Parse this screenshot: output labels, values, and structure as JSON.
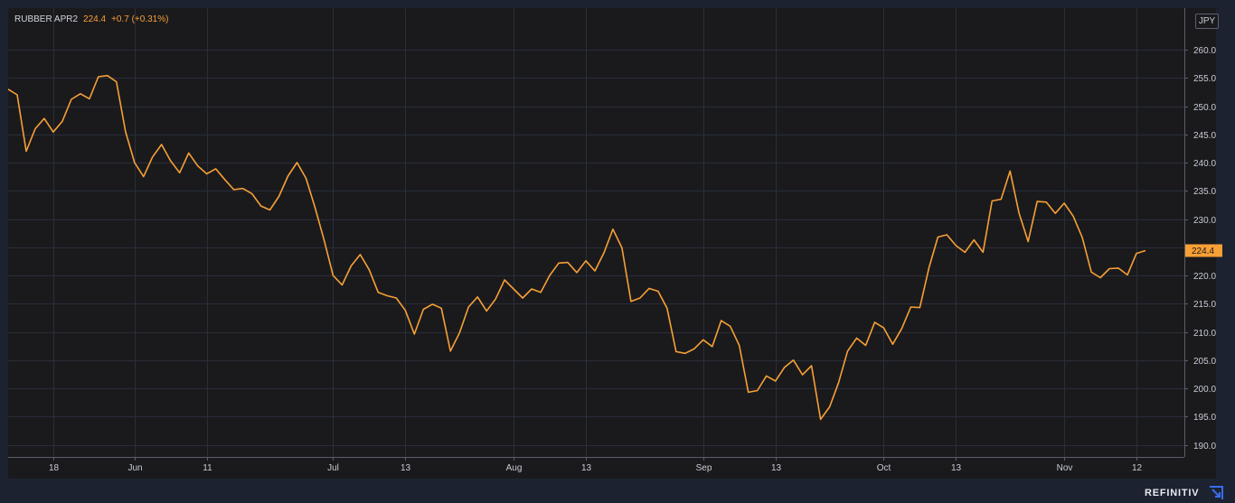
{
  "legend": {
    "symbol": "RUBBER APR2",
    "price": "224.4",
    "change": "+0.7 (+0.31%)"
  },
  "currency": "JPY",
  "brand": {
    "name": "REFINITIV",
    "logo_icon": "refinitiv-logo-icon"
  },
  "colors": {
    "background": "#1a1a1d",
    "frame": "#1c2230",
    "line": "#f7a035",
    "grid": "#2a2e39",
    "text": "#d1d4dc"
  },
  "chart_data": {
    "type": "line",
    "title": "",
    "xlabel": "",
    "ylabel": "",
    "ylim": [
      187.5,
      265
    ],
    "grid": true,
    "y_ticks": [
      "190.0",
      "195.0",
      "200.0",
      "205.0",
      "210.0",
      "215.0",
      "220.0",
      "225.0",
      "230.0",
      "235.0",
      "240.0",
      "245.0",
      "250.0",
      "255.0",
      "260.0"
    ],
    "x_ticks": [
      {
        "label": "18",
        "index": 5
      },
      {
        "label": "Jun",
        "index": 14
      },
      {
        "label": "11",
        "index": 22
      },
      {
        "label": "Jul",
        "index": 36
      },
      {
        "label": "13",
        "index": 44
      },
      {
        "label": "Aug",
        "index": 56
      },
      {
        "label": "13",
        "index": 64
      },
      {
        "label": "Sep",
        "index": 77
      },
      {
        "label": "13",
        "index": 85
      },
      {
        "label": "Oct",
        "index": 97
      },
      {
        "label": "13",
        "index": 105
      },
      {
        "label": "Nov",
        "index": 117
      },
      {
        "label": "12",
        "index": 125
      }
    ],
    "last_value_label": "224.4",
    "series": [
      {
        "values": [
          253,
          252,
          242,
          246,
          247.8,
          245.4,
          247.3,
          251.2,
          252.2,
          251.3,
          255.2,
          255.4,
          254.3,
          245.5,
          240,
          237.5,
          241,
          243.2,
          240.3,
          238.2,
          241.7,
          239.4,
          238,
          238.9,
          237,
          235.2,
          235.4,
          234.5,
          232.3,
          231.6,
          234,
          237.6,
          240,
          237.2,
          232,
          226.3,
          220,
          218.3,
          221.7,
          223.7,
          221,
          217,
          216.4,
          216,
          213.8,
          209.6,
          214,
          214.9,
          214.2,
          206.6,
          209.8,
          214.4,
          216.2,
          213.7,
          215.8,
          219.2,
          217.6,
          216,
          217.6,
          217,
          220,
          222.2,
          222.3,
          220.5,
          222.6,
          220.8,
          224,
          228.2,
          224.9,
          215.4,
          216,
          217.7,
          217.2,
          214.2,
          206.5,
          206.2,
          207,
          208.6,
          207.4,
          212,
          211,
          207.6,
          199.3,
          199.6,
          202.2,
          201.3,
          203.7,
          205,
          202.4,
          204,
          194.5,
          196.7,
          201,
          206.6,
          208.9,
          207.6,
          211.7,
          210.7,
          207.8,
          210.6,
          214.4,
          214.3,
          221.3,
          226.8,
          227.2,
          225.3,
          224.1,
          226.3,
          224.1,
          233.2,
          233.5,
          238.5,
          231,
          226,
          233.1,
          233,
          231,
          232.8,
          230.5,
          226.7,
          220.6,
          219.6,
          221.2,
          221.3,
          220.1,
          223.9,
          224.4
        ]
      }
    ]
  }
}
